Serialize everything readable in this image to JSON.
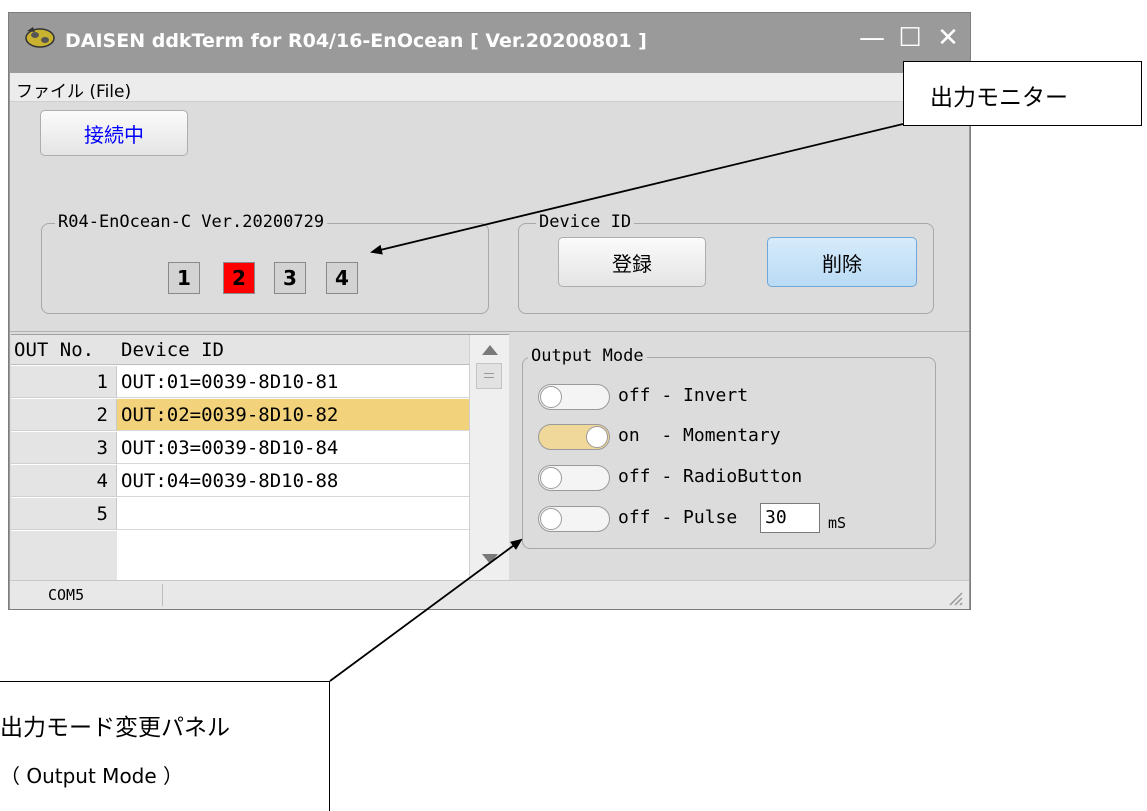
{
  "window": {
    "title": "DAISEN ddkTerm for R04/16-EnOcean [ Ver.20200801 ]",
    "controls": {
      "minimize": "—",
      "maximize": "☐",
      "close": "✕"
    }
  },
  "menu": {
    "file_label": "ファイル (File)"
  },
  "connect_button": "接続中",
  "monitor_group": {
    "legend": "R04-EnOcean-C Ver.20200729",
    "boxes": [
      {
        "label": "1",
        "state": "off"
      },
      {
        "label": "2",
        "state": "on"
      },
      {
        "label": "3",
        "state": "off"
      },
      {
        "label": "4",
        "state": "off"
      }
    ]
  },
  "device_group": {
    "legend": "Device ID",
    "register_label": "登録",
    "delete_label": "削除"
  },
  "table": {
    "columns": [
      "OUT No.",
      "Device ID"
    ],
    "rows": [
      {
        "no": "1",
        "device_id": "OUT:01=0039-8D10-81",
        "selected": false
      },
      {
        "no": "2",
        "device_id": "OUT:02=0039-8D10-82",
        "selected": true
      },
      {
        "no": "3",
        "device_id": "OUT:03=0039-8D10-84",
        "selected": false
      },
      {
        "no": "4",
        "device_id": "OUT:04=0039-8D10-88",
        "selected": false
      },
      {
        "no": "5",
        "device_id": "",
        "selected": false
      }
    ]
  },
  "output_mode": {
    "legend": "Output Mode",
    "options": [
      {
        "label": "off - Invert",
        "state": "off"
      },
      {
        "label": "on  - Momentary",
        "state": "on"
      },
      {
        "label": "off - RadioButton",
        "state": "off"
      },
      {
        "label": "off - Pulse",
        "state": "off"
      }
    ],
    "pulse_value": "30",
    "pulse_unit": "mS"
  },
  "status": {
    "port": "COM5"
  },
  "annotations": {
    "monitor_label": "出力モニター",
    "panel_label_line1": "出力モード変更パネル",
    "panel_label_line2": "（ Output Mode ）"
  },
  "colors": {
    "monitor_on": "#ff0000",
    "selected_row": "#f2d27b",
    "toggle_on": "#f0d89a",
    "connect_text": "#0000ff"
  }
}
